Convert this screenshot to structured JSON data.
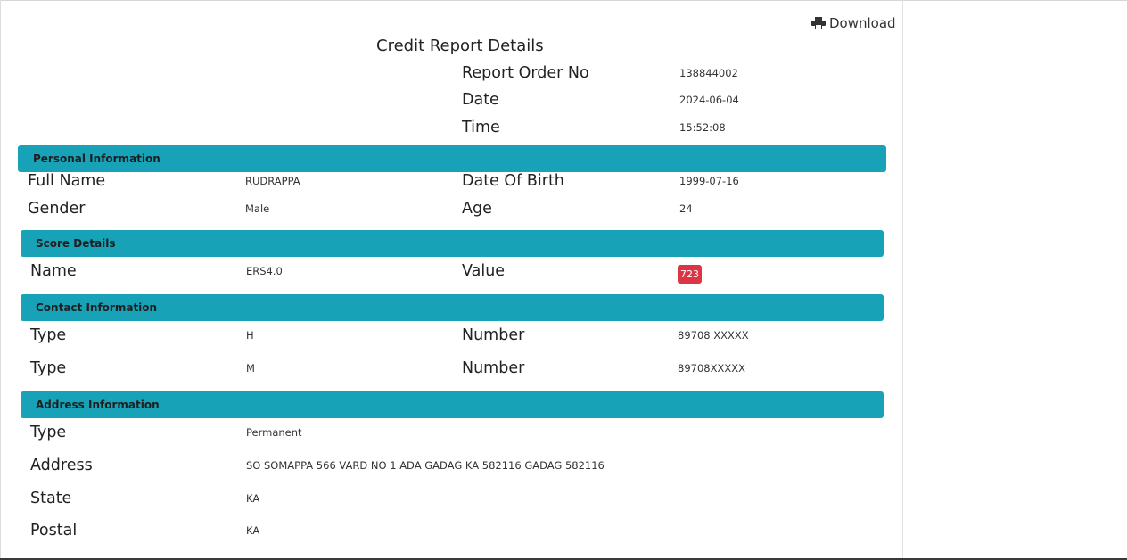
{
  "header": {
    "download_label": "Download",
    "title": "Credit Report Details"
  },
  "report": {
    "order_no_label": "Report Order No",
    "order_no": "138844002",
    "date_label": "Date",
    "date": "2024-06-04",
    "time_label": "Time",
    "time": "15:52:08"
  },
  "personal": {
    "heading": "Personal Information",
    "full_name_label": "Full Name",
    "full_name": "RUDRAPPA",
    "dob_label": "Date Of Birth",
    "dob": "1999-07-16",
    "gender_label": "Gender",
    "gender": "Male",
    "age_label": "Age",
    "age": "24"
  },
  "score": {
    "heading": "Score Details",
    "name_label": "Name",
    "name": "ERS4.0",
    "value_label": "Value",
    "value": "723",
    "badge_color": "#dc3545"
  },
  "contact": {
    "heading": "Contact Information",
    "rows": [
      {
        "type_label": "Type",
        "type": "H",
        "number_label": "Number",
        "number": "89708 XXXXX"
      },
      {
        "type_label": "Type",
        "type": "M",
        "number_label": "Number",
        "number": "89708XXXXX"
      }
    ]
  },
  "address": {
    "heading": "Address Information",
    "type_label": "Type",
    "type": "Permanent",
    "address_label": "Address",
    "address": "SO SOMAPPA 566 VARD NO 1 ADA GADAG KA 582116 GADAG 582116",
    "state_label": "State",
    "state": "KA",
    "postal_label": "Postal",
    "postal": "KA"
  },
  "colors": {
    "section_header": "#17a2b8",
    "badge": "#dc3545"
  }
}
